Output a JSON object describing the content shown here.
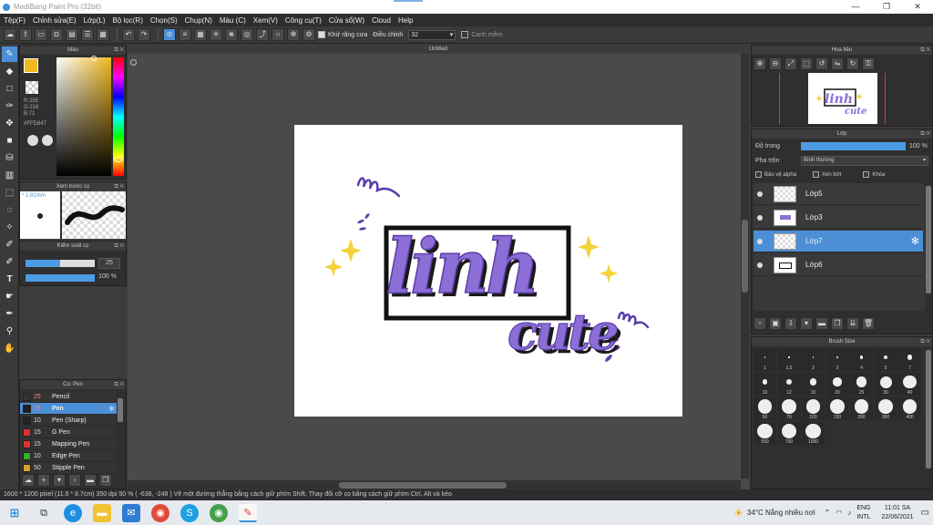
{
  "window": {
    "title": "MediBang Paint Pro (32bit)",
    "controls": [
      "—",
      "❐",
      "✕"
    ]
  },
  "menu": [
    "Tệp(F)",
    "Chỉnh sửa(E)",
    "Lớp(L)",
    "Bộ lọc(R)",
    "Chọn(S)",
    "Chụp(N)",
    "Màu (C)",
    "Xem(V)",
    "Công cụ(T)",
    "Cửa sổ(W)",
    "Cloud",
    "Help"
  ],
  "toolbar": {
    "antialias_label": "Khử răng cưa",
    "adjust_label": "Điều chỉnh",
    "adjust_value": "32",
    "snap_label": "Canh mềm"
  },
  "color_panel": {
    "title": "Màu",
    "accent": "#f0b820",
    "r": "R:255",
    "g": "G:216",
    "b": "B:71",
    "hex": "#FFD847"
  },
  "brush_preview": {
    "title": "Xem trước cọ",
    "size": "1.81mm"
  },
  "brush_control": {
    "title": "Kiểm soát cọ",
    "size_value": "25",
    "opacity_value": "100 %"
  },
  "brush_list": {
    "title": "Cọ: Pen",
    "items": [
      {
        "size": "25",
        "name": "Pencil",
        "color": "#333333"
      },
      {
        "size": "25",
        "name": "Pen",
        "color": "#1d1d1d"
      },
      {
        "size": "10",
        "name": "Pen (Sharp)",
        "color": "#222222"
      },
      {
        "size": "15",
        "name": "G Pen",
        "color": "#e03030"
      },
      {
        "size": "15",
        "name": "Mapping Pen",
        "color": "#e03030"
      },
      {
        "size": "10",
        "name": "Edge Pen",
        "color": "#30b030"
      },
      {
        "size": "50",
        "name": "Stipple Pen",
        "color": "#e0a020"
      }
    ]
  },
  "canvas": {
    "tab_title": "Untitled"
  },
  "navigator": {
    "title": "Hoa tiêu"
  },
  "layers": {
    "title": "Lớp",
    "opacity_label": "Độ trong",
    "opacity_value": "100 %",
    "blend_label": "Pha trộn",
    "blend_value": "Bình thường",
    "protect_alpha": "Bảo vệ alpha",
    "clipping": "Xén bớt",
    "lock": "Khóa",
    "items": [
      "Lớp5",
      "Lớp3",
      "Lớp7",
      "Lớp6"
    ]
  },
  "brush_size": {
    "title": "Brush Size",
    "labels": [
      "1",
      "1.5",
      "2",
      "3",
      "4",
      "5",
      "7",
      "10",
      "12",
      "15",
      "20",
      "25",
      "30",
      "40",
      "50",
      "70",
      "100",
      "150",
      "200",
      "300",
      "400",
      "500",
      "700",
      "1000"
    ]
  },
  "status": {
    "text": "1600 * 1200 pixel  (11.6 * 8.7cm)  350 dpi  50 %  ( -638, -248 )  Vẽ một đường thẳng bằng cách giữ phím Shift, Thay đổi cỡ cọ bằng cách giữ phím Ctrl, Alt và kéo"
  },
  "taskbar": {
    "weather": "34°C  Nắng nhiều nơi",
    "lang1": "ENG",
    "lang2": "INTL",
    "time": "11:01 SA",
    "date": "22/06/2021"
  },
  "artwork": {
    "word1": "linh",
    "word2": "cute",
    "letter_color": "#8c6fd6",
    "shadow_color": "#1a1a1a",
    "sparkle_color": "#f3d23a"
  }
}
